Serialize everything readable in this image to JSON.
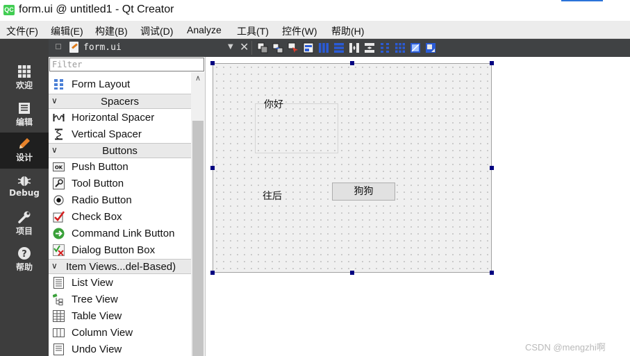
{
  "window": {
    "logo_text": "QC",
    "title": "form.ui @ untitled1 - Qt Creator"
  },
  "menubar": {
    "items": [
      {
        "label": "文件(F)"
      },
      {
        "label": "编辑(E)"
      },
      {
        "label": "构建(B)"
      },
      {
        "label": "调试(D)"
      },
      {
        "label": "Analyze"
      },
      {
        "label": "工具(T)"
      },
      {
        "label": "控件(W)"
      },
      {
        "label": "帮助(H)"
      }
    ]
  },
  "modebar": {
    "modes": [
      {
        "label": "欢迎",
        "icon": "grid-icon"
      },
      {
        "label": "编辑",
        "icon": "document-icon"
      },
      {
        "label": "设计",
        "icon": "pencil-icon",
        "active": true
      },
      {
        "label": "Debug",
        "icon": "bug-icon"
      },
      {
        "label": "项目",
        "icon": "wrench-icon"
      },
      {
        "label": "帮助",
        "icon": "help-icon"
      }
    ]
  },
  "toolbar": {
    "file_name": "form.ui",
    "close_glyph": "✕",
    "dropdown_glyph": "▼"
  },
  "widgetbox": {
    "filter_placeholder": "Filter",
    "items": {
      "form_layout": "Form Layout",
      "horizontal_spacer": "Horizontal Spacer",
      "vertical_spacer": "Vertical Spacer",
      "push_button": "Push Button",
      "tool_button": "Tool Button",
      "radio_button": "Radio Button",
      "check_box": "Check Box",
      "command_link_button": "Command Link Button",
      "dialog_button_box": "Dialog Button Box",
      "list_view": "List View",
      "tree_view": "Tree View",
      "table_view": "Table View",
      "column_view": "Column View",
      "undo_view": "Undo View"
    },
    "categories": {
      "spacers": "Spacers",
      "buttons": "Buttons",
      "item_views": "Item Views...del-Based)"
    },
    "icon_text": {
      "push_button": "OK"
    }
  },
  "form": {
    "label_hello": "你好",
    "label_back": "往后",
    "push_button": "狗狗"
  },
  "watermark": "CSDN @mengzhi啊",
  "colors": {
    "modebar_bg": "#3d3d3d",
    "toolbar_bg": "#404244",
    "selection_handle": "#000080",
    "qt_green": "#41cd52"
  }
}
